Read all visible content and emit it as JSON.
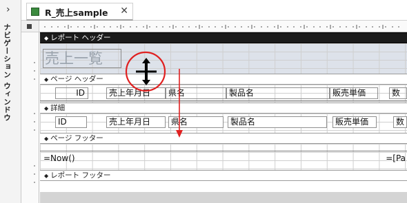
{
  "nav_pane": {
    "chevron": "›",
    "label": "ナビゲーション ウィンドウ"
  },
  "tab": {
    "title": "R_売上sample",
    "close": "✕"
  },
  "sections": {
    "report_header": "レポート ヘッダー",
    "page_header": "ページ ヘッダー",
    "detail": "詳細",
    "page_footer": "ページ フッター",
    "report_footer": "レポート フッター"
  },
  "report_header": {
    "title": "売上一覧"
  },
  "page_header_labels": [
    "ID",
    "売上年月日",
    "県名",
    "製品名",
    "販売単価",
    "数"
  ],
  "detail_fields": [
    "ID",
    "売上年月日",
    "県名",
    "製品名",
    "販売単価",
    "数"
  ],
  "page_footer": {
    "now": "=Now()",
    "page": "=[Pa"
  },
  "colors": {
    "selected_bar": "#1b1b1b",
    "annotation": "#e02020",
    "header_band": "#dde2ea"
  },
  "icons": {
    "cursor": "resize-move-cursor",
    "arrow": "down-arrow"
  }
}
